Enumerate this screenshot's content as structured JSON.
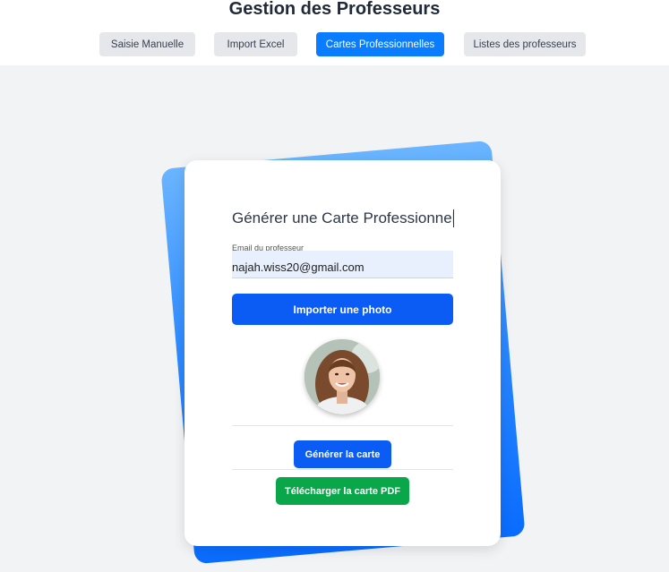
{
  "header": {
    "title": "Gestion des Professeurs",
    "tabs": [
      {
        "label": "Saisie Manuelle",
        "active": false
      },
      {
        "label": "Import Excel",
        "active": false
      },
      {
        "label": "Cartes Professionnelles",
        "active": true
      },
      {
        "label": "Listes des professeurs",
        "active": false
      }
    ]
  },
  "card": {
    "title": "Générer une Carte Professionnelle",
    "email_label": "Email du professeur",
    "email_value": "najah.wiss20@gmail.com",
    "import_photo_label": "Importer une photo",
    "generate_label": "Générer la carte",
    "download_label": "Télécharger la carte PDF"
  },
  "colors": {
    "primary": "#0b5cf5",
    "active_tab": "#0a7cff",
    "success": "#0aa64a",
    "background": "#f2f3f5"
  }
}
